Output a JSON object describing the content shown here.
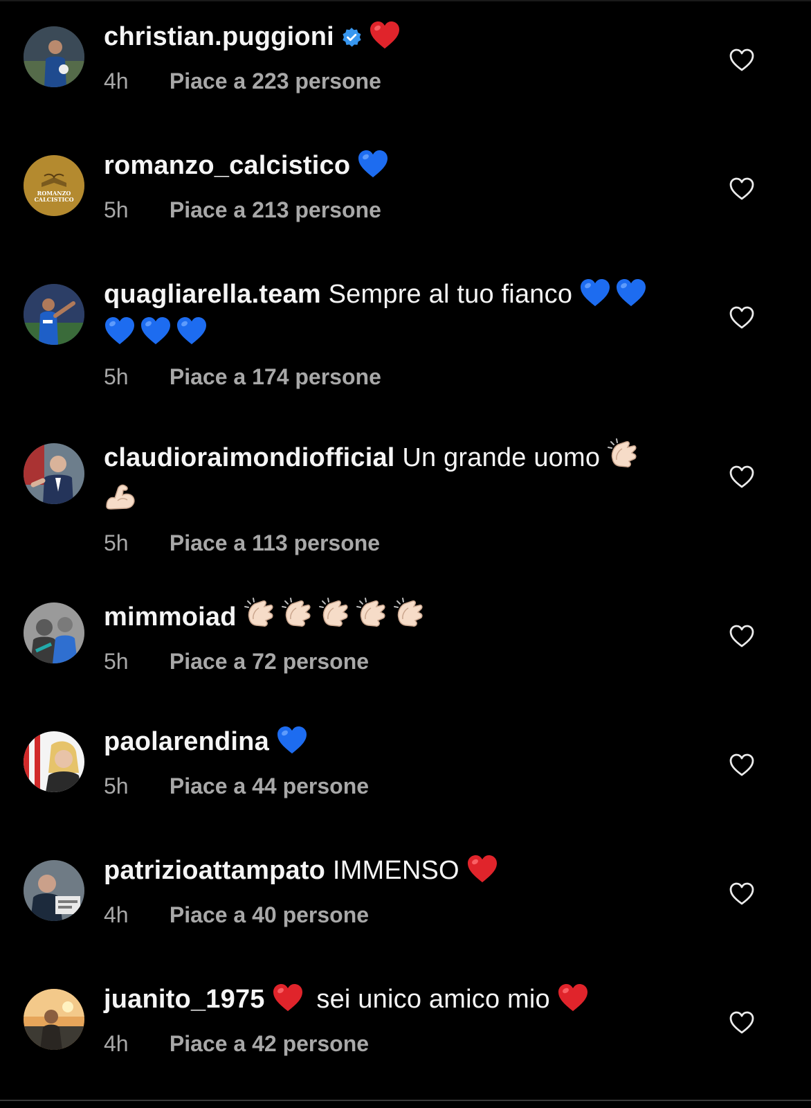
{
  "colors": {
    "background": "#000000",
    "primary_text": "#f5f5f5",
    "secondary_text": "#a8a8a8",
    "verified_blue": "#3897f0",
    "red_heart": "#e0242b",
    "blue_heart": "#1d6cf0"
  },
  "comments": [
    {
      "username": "christian.puggioni",
      "verified": true,
      "text": "",
      "emojis_after_name": [
        "red-heart"
      ],
      "time": "4h",
      "likes": "Piace a 223 persone"
    },
    {
      "username": "romanzo_calcistico",
      "avatar_label_1": "ROMANZO",
      "avatar_label_2": "CALCISTICO",
      "text": "",
      "emojis_after_name": [
        "blue-heart"
      ],
      "time": "5h",
      "likes": "Piace a 213 persone"
    },
    {
      "username": "quagliarella.team",
      "text": "Sempre al tuo fianco",
      "emojis_after_text": [
        "blue-heart",
        "blue-heart",
        "blue-heart",
        "blue-heart",
        "blue-heart"
      ],
      "time": "5h",
      "likes": "Piace a 174 persone"
    },
    {
      "username": "claudioraimondiofficial",
      "text": "Un grande uomo",
      "emojis_after_text": [
        "clapping-hands",
        "flexed-biceps"
      ],
      "time": "5h",
      "likes": "Piace a 113 persone"
    },
    {
      "username": "mimmoiad",
      "text": "",
      "emojis_after_name": [
        "clapping-hands",
        "clapping-hands",
        "clapping-hands",
        "clapping-hands",
        "clapping-hands"
      ],
      "time": "5h",
      "likes": "Piace a 72 persone"
    },
    {
      "username": "paolarendina",
      "text": "",
      "emojis_after_name": [
        "blue-heart"
      ],
      "time": "5h",
      "likes": "Piace a 44 persone"
    },
    {
      "username": "patrizioattampato",
      "text": "IMMENSO",
      "emojis_after_text": [
        "red-heart"
      ],
      "time": "4h",
      "likes": "Piace a 40 persone"
    },
    {
      "username": "juanito_1975",
      "text_before": "",
      "text": "sei unico amico mio",
      "emojis_before_text": [
        "red-heart"
      ],
      "emojis_after_text": [
        "red-heart"
      ],
      "time": "4h",
      "likes": "Piace a 42 persone"
    }
  ]
}
